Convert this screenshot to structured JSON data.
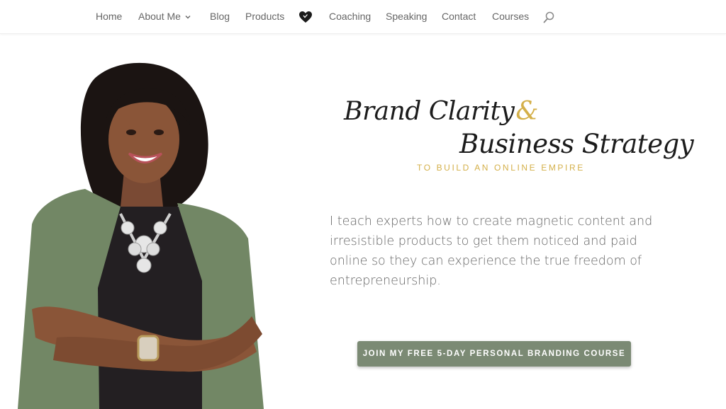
{
  "nav": {
    "items": [
      {
        "label": "Home"
      },
      {
        "label": "About Me"
      },
      {
        "label": "Blog"
      },
      {
        "label": "Products"
      },
      {
        "label": "Coaching"
      },
      {
        "label": "Speaking"
      },
      {
        "label": "Contact"
      },
      {
        "label": "Courses"
      }
    ],
    "icons": [
      "chevron-down-icon",
      "heart-icon",
      "search-icon"
    ]
  },
  "hero": {
    "headline_line1": "Brand Clarity",
    "headline_amp": "&",
    "headline_line2": "Business Strategy",
    "tagline": "TO BUILD AN ONLINE EMPIRE",
    "description": "I teach experts how to create magnetic content and irresistible products to get them noticed and paid online so they can experience the true freedom of entrepreneurship.",
    "cta_label": "JOIN MY FREE 5-DAY PERSONAL BRANDING COURSE"
  },
  "colors": {
    "nav_text": "#666666",
    "gold_accent": "#d4b04a",
    "cta_background": "#7b8a74",
    "body_text": "#666666",
    "headline_text": "#1c1c1c"
  }
}
